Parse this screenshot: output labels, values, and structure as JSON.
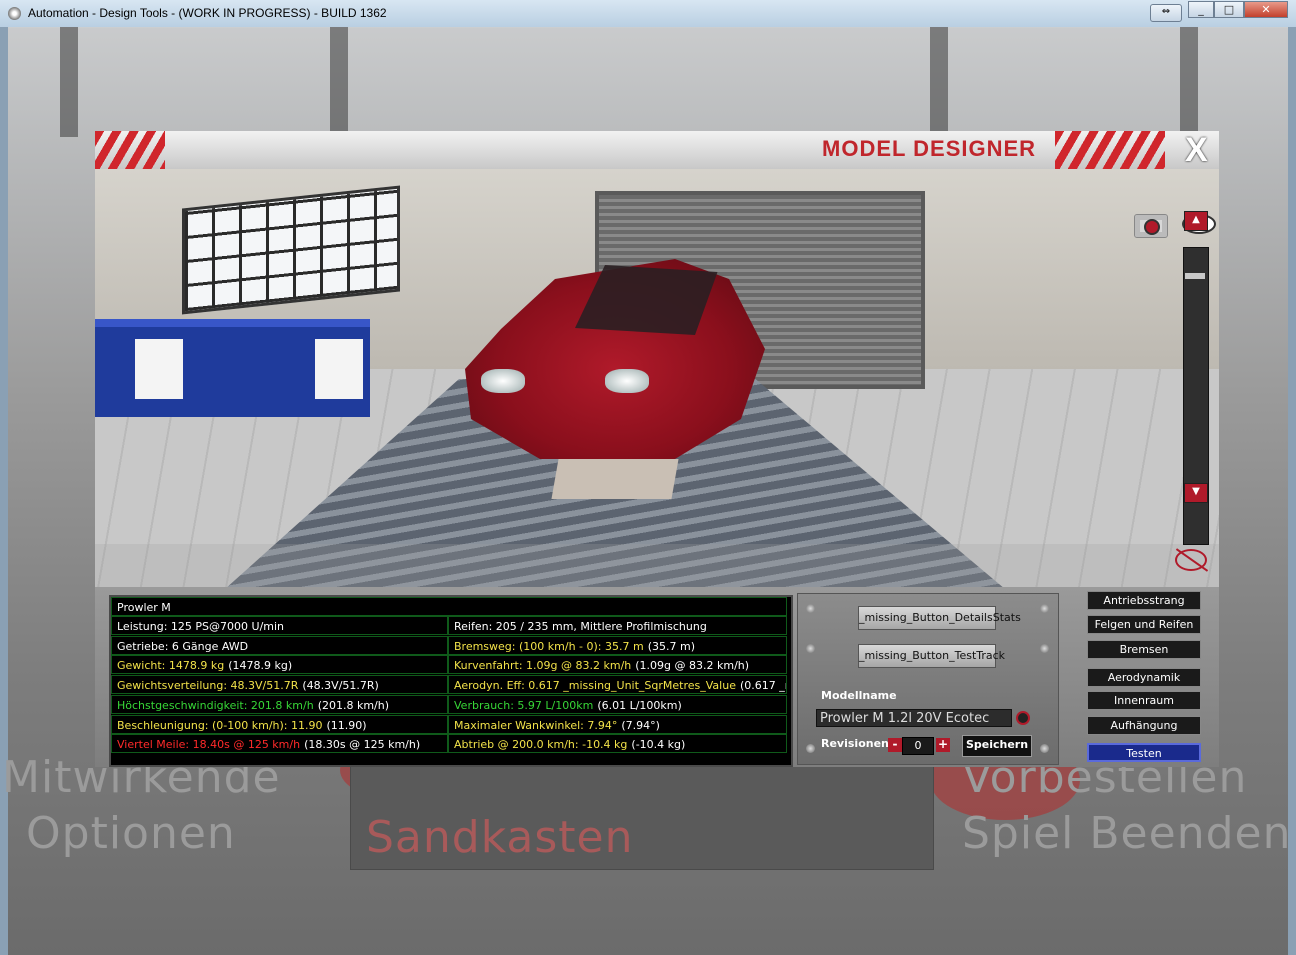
{
  "window": {
    "title": "Automation - Design Tools - (WORK IN PROGRESS) - BUILD 1362"
  },
  "backdrop": {
    "left_labels": [
      "Mitwirkende",
      "Optionen"
    ],
    "center_label": "Sandkasten",
    "right_labels": [
      "Vorbestellen",
      "Spiel Beenden"
    ]
  },
  "designer": {
    "title": "MODEL DESIGNER",
    "close_label": "X",
    "stats": {
      "model": "Prowler M",
      "left": [
        {
          "label": "Leistung: 125 PS@7000 U/min",
          "extra": "",
          "color": "white"
        },
        {
          "label": "Getriebe: 6 Gänge AWD",
          "extra": "",
          "color": "white"
        },
        {
          "label": "Gewicht: 1478.9 kg",
          "extra": "(1478.9 kg)",
          "color": "yellow"
        },
        {
          "label": "Gewichtsverteilung: 48.3V/51.7R",
          "extra": "(48.3V/51.7R)",
          "color": "yellow"
        },
        {
          "label": "Höchstgeschwindigkeit: 201.8 km/h",
          "extra": "(201.8 km/h)",
          "color": "green"
        },
        {
          "label": "Beschleunigung: (0-100 km/h): 11.90",
          "extra": "(11.90)",
          "color": "yellow"
        },
        {
          "label": "Viertel Meile: 18.40s @ 125 km/h",
          "extra": "(18.30s @ 125 km/h)",
          "color": "red"
        }
      ],
      "right": [
        {
          "label": "Reifen: 205 / 235 mm, Mittlere Profilmischung",
          "extra": "",
          "color": "white"
        },
        {
          "label": "Bremsweg: (100 km/h - 0): 35.7 m",
          "extra": "(35.7 m)",
          "color": "yellow"
        },
        {
          "label": "Kurvenfahrt: 1.09g @ 83.2 km/h",
          "extra": "(1.09g @ 83.2 km/h)",
          "color": "yellow"
        },
        {
          "label": "Aerodyn. Eff: 0.617 _missing_Unit_SqrMetres_Value",
          "extra": "(0.617 _missing_Unit_SqrMetres_Value)",
          "color": "yellow"
        },
        {
          "label": "Verbrauch: 5.97 L/100km",
          "extra": "(6.01 L/100km)",
          "color": "green"
        },
        {
          "label": "Maximaler Wankwinkel: 7.94°",
          "extra": "(7.94°)",
          "color": "yellow"
        },
        {
          "label": "Abtrieb @ 200.0 km/h: -10.4 kg",
          "extra": "(-10.4 kg)",
          "color": "yellow"
        }
      ]
    },
    "buttons": {
      "details_stats": "_missing_Button_DetailsStats",
      "test_track": "_missing_Button_TestTrack"
    },
    "model_name_label": "Modellname",
    "model_name_value": "Prowler M 1.2l 20V Ecotec",
    "revisions_label": "Revisionen",
    "revisions_value": "0",
    "save_label": "Speichern",
    "menu": [
      "Antriebsstrang",
      "Felgen und Reifen",
      "Bremsen",
      "Aerodynamik",
      "Innenraum",
      "Aufhängung",
      "Testen"
    ],
    "active_menu": "Testen"
  },
  "colors": {
    "accent_red": "#c0262c",
    "stat_yellow": "#f2e24a",
    "stat_green": "#37d637",
    "stat_red": "#ff2a2a",
    "active_menu_blue": "#1a2a8c"
  },
  "icons": {
    "camera": "camera-icon",
    "eye": "eye-icon",
    "eye_off": "eye-off-icon",
    "refresh": "refresh-icon"
  }
}
